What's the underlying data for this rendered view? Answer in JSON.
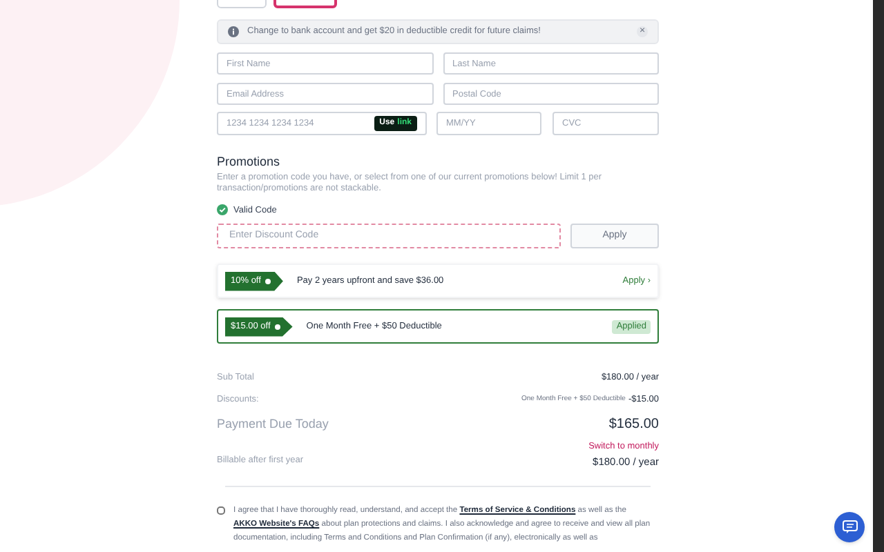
{
  "payment_tabs": [
    {
      "selected": false
    },
    {
      "selected": true
    }
  ],
  "notice": {
    "text": "Change to bank account and get $20 in deductible credit for future claims!",
    "close": "×"
  },
  "fields": [
    {
      "placeholder": "First Name"
    },
    {
      "placeholder": "Last Name"
    },
    {
      "placeholder": "Email Address"
    },
    {
      "placeholder": "Postal Code"
    }
  ],
  "card": {
    "number_placeholder": "1234 1234 1234 1234",
    "link_badge": [
      "Use",
      "link"
    ],
    "expiry_placeholder": "MM/YY",
    "cvc_placeholder": "CVC"
  },
  "promotions": {
    "title": "Promotions",
    "description": "Enter a promotion code you have, or select from one of our current promotions below! Limit 1 per transaction/promotions are not stackable.",
    "valid_label": "Valid Code",
    "code_placeholder": "Enter Discount Code",
    "apply_button": "Apply",
    "offers": [
      {
        "tag": "10% off",
        "text": "Pay 2 years upfront and save $36.00",
        "action": "Apply ›",
        "applied": false
      },
      {
        "tag": "$15.00 off",
        "text": "One Month Free + $50 Deductible",
        "action": "Applied",
        "applied": true
      }
    ]
  },
  "summary": {
    "sub_total": {
      "label": "Sub Total",
      "value": "$180.00 / year"
    },
    "discounts": {
      "label": "Discounts:",
      "note": "One Month Free + $50 Deductible",
      "value": "-$15.00"
    },
    "due": {
      "label": "Payment Due Today",
      "value": "$165.00"
    },
    "switch_link": "Switch to monthly",
    "billable": {
      "label": "Billable after first year",
      "value": "$180.00 / year"
    }
  },
  "agreement": {
    "checked": false,
    "parts": [
      {
        "kind": "text",
        "text": "I agree that I have thoroughly read, understand, and accept the "
      },
      {
        "kind": "link",
        "text": "Terms of Service & Conditions"
      },
      {
        "kind": "text",
        "text": " as well as the "
      },
      {
        "kind": "link",
        "text": "AKKO Website's FAQs"
      },
      {
        "kind": "text",
        "text": " about plan protections and claims. I also acknowledge and agree to receive and view all plan documentation, including Terms and Conditions and Plan Confirmation (if any), electronically as well as"
      }
    ]
  }
}
